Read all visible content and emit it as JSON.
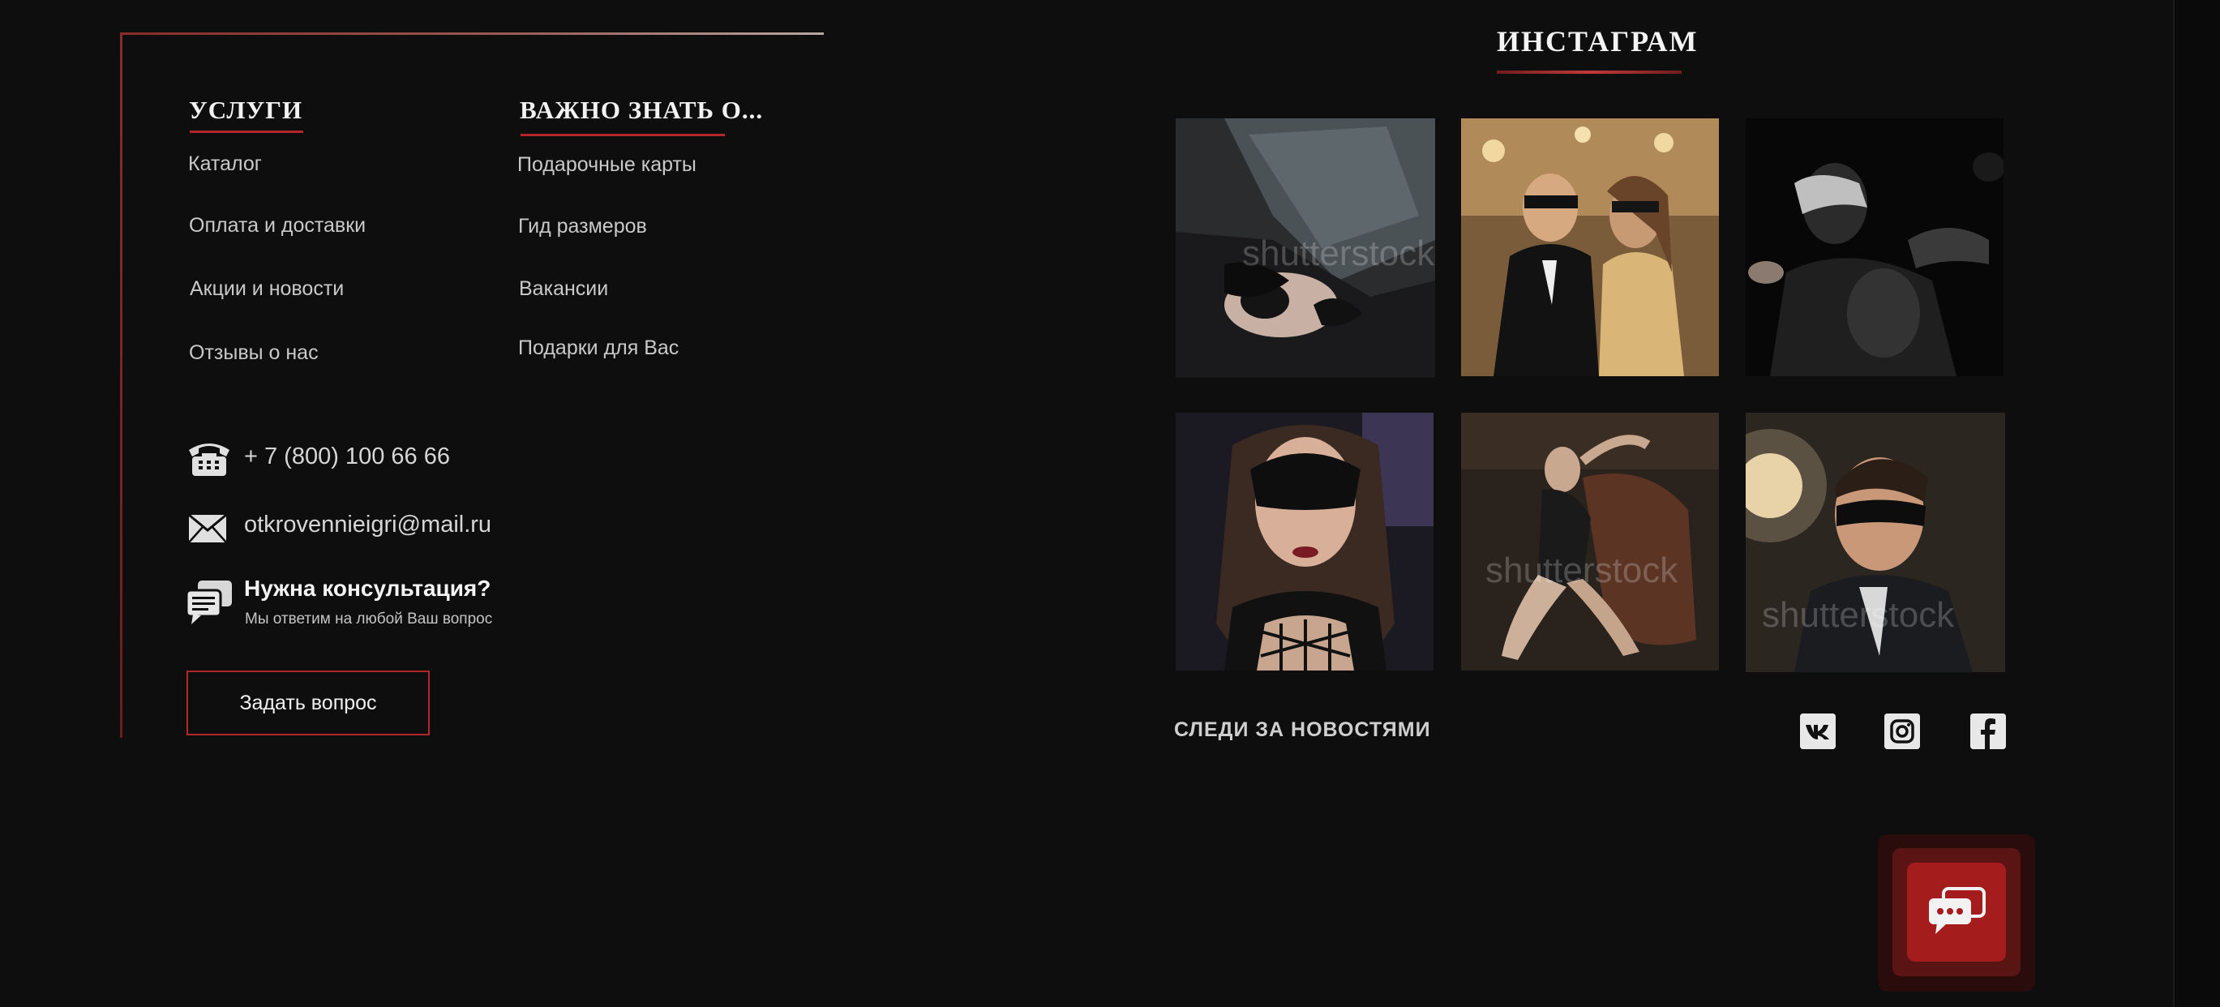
{
  "services": {
    "heading": "УСЛУГИ",
    "links": [
      "Каталог",
      "Оплата и доставки",
      "Акции и новости",
      "Отзывы о нас"
    ]
  },
  "important": {
    "heading": "ВАЖНО ЗНАТЬ О...",
    "links": [
      "Подарочные карты",
      "Гид размеров",
      "Вакансии",
      "Подарки для Вас"
    ]
  },
  "contacts": {
    "phone": "+ 7 (800) 100 66 66",
    "email": "otkrovennieigri@mail.ru",
    "consult_title": "Нужна консультация?",
    "consult_subtitle": "Мы ответим на любой Ваш вопрос",
    "ask_button": "Задать вопрос"
  },
  "instagram": {
    "heading": "ИНСТАГРАМ",
    "watermark": "shutterstock",
    "photos": [
      "instagram-photo-1",
      "instagram-photo-2",
      "instagram-photo-3",
      "instagram-photo-4",
      "instagram-photo-5",
      "instagram-photo-6"
    ]
  },
  "follow": {
    "label": "СЛЕДИ ЗА НОВОСТЯМИ",
    "icons": [
      "vk-icon",
      "instagram-icon",
      "facebook-icon"
    ]
  },
  "chat_widget": {
    "icon": "chat-bubbles-icon"
  },
  "colors": {
    "background": "#0e0e0f",
    "accent": "#b3262a",
    "chat_button": "#a41c1c"
  }
}
